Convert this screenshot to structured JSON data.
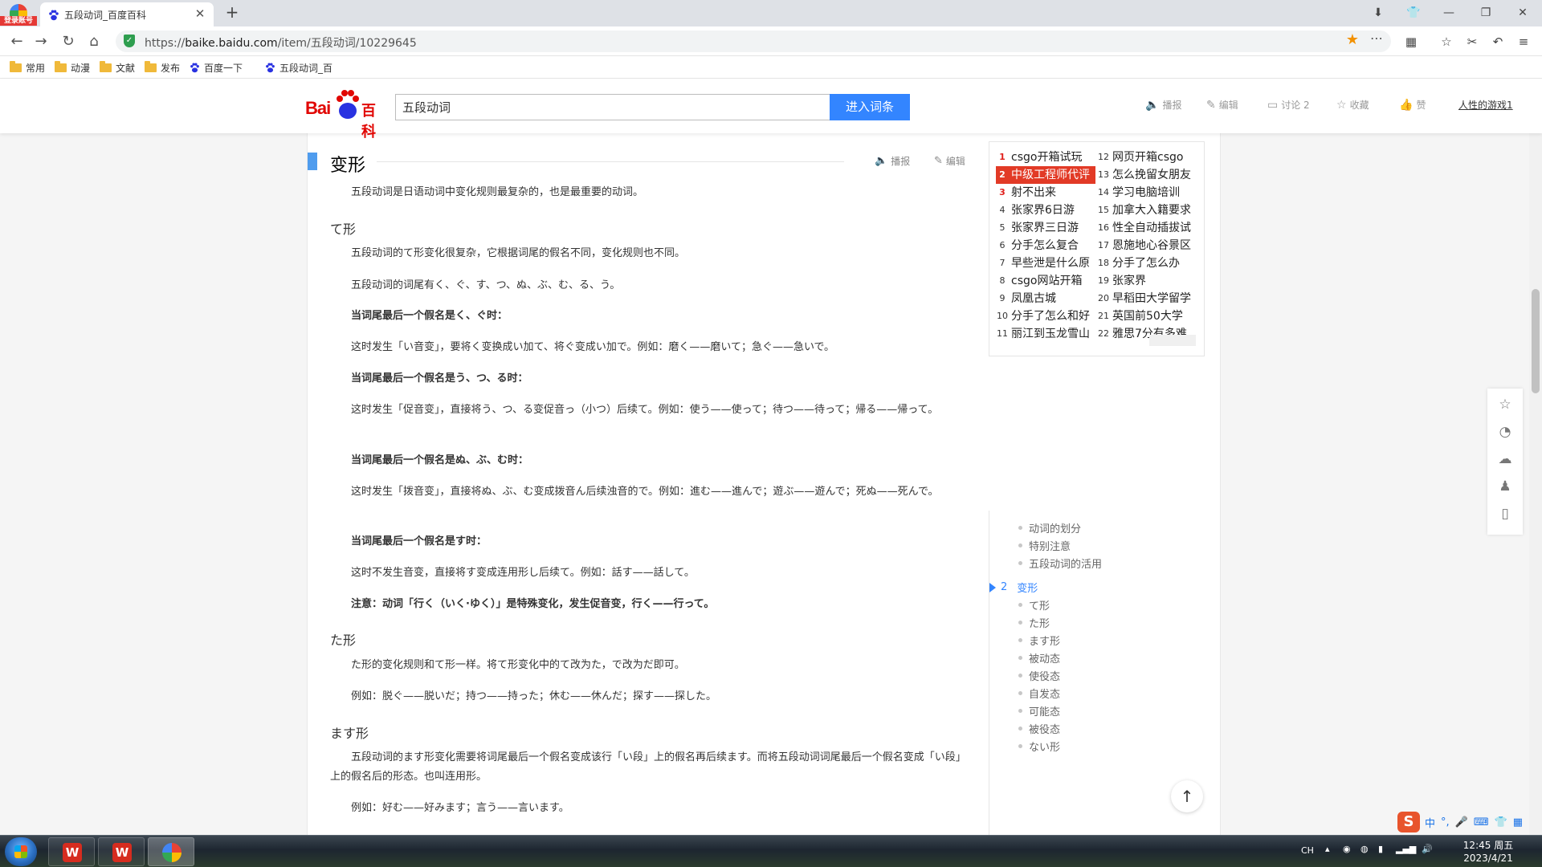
{
  "browser": {
    "login_badge": "登录账号",
    "tab_title": "五段动词_百度百科",
    "url_scheme": "https://",
    "url_host": "baike.baidu.com",
    "url_path": "/item/五段动词/10229645"
  },
  "bookmarks": [
    {
      "label": "常用",
      "icon": "folder-icon"
    },
    {
      "label": "动漫",
      "icon": "folder-icon"
    },
    {
      "label": "文献",
      "icon": "folder-icon"
    },
    {
      "label": "发布",
      "icon": "folder-icon"
    },
    {
      "label": "百度一下",
      "icon": "baidu-paw-icon"
    },
    {
      "label": "五段动词_百",
      "icon": "baidu-paw-icon"
    }
  ],
  "header": {
    "logo_bai": "Bai",
    "logo_baike": "百科",
    "search_value": "五段动词",
    "search_button": "进入词条",
    "actions": {
      "broadcast": "播报",
      "edit": "编辑",
      "discuss": "讨论 2",
      "collect": "收藏",
      "like": "赞"
    },
    "user": "人性的游戏1"
  },
  "section": {
    "title": "变形",
    "broadcast": "播报",
    "edit": "编辑"
  },
  "article": {
    "intro": "五段动词是日语动词中变化规则最复杂的，也是最重要的动词。",
    "h_te": "て形",
    "te_1": "五段动词的て形变化很复杂，它根据词尾的假名不同，变化规则也不同。",
    "te_2": "五段动词的词尾有く、ぐ、す、つ、ぬ、ぶ、む、る、う。",
    "te_3": "当词尾最后一个假名是く、ぐ时：",
    "te_4": "这时发生「い音变」，要将く变换成い加て、将ぐ变成い加で。例如：磨く——磨いて；急ぐ——急いで。",
    "te_5": "当词尾最后一个假名是う、つ、る时：",
    "te_6": "这时发生「促音变」，直接将う、つ、る变促音っ（小つ）后续て。例如：使う——使って；待つ——待って；帰る——帰って。",
    "te_7": "当词尾最后一个假名是ぬ、ぶ、む时：",
    "te_8": "这时发生「拨音变」，直接将ぬ、ぶ、む变成拨音ん后续浊音的で。例如：進む——進んで；遊ぶ——遊んで；死ぬ——死んで。",
    "te_9": "当词尾最后一个假名是す时：",
    "te_10": "这时不发生音变，直接将す变成连用形し后续て。例如：話す——話して。",
    "te_11": "注意：动词「行く（いく·ゆく）」是特殊变化，发生促音变，行く——行って。",
    "h_ta": "た形",
    "ta_1": "た形的变化规则和て形一样。将て形变化中的て改为た，で改为だ即可。",
    "ta_2": "例如：脱ぐ——脱いだ；持つ——持った；休む——休んだ；探す——探した。",
    "h_masu": "ます形",
    "masu_1": "五段动词的ます形变化需要将词尾最后一个假名变成该行「い段」上的假名再后续ます。而将五段动词词尾最后一个假名变成「い段」上的假名后的形态。也叫连用形。",
    "masu_2": "例如：好む——好みます；言う——言います。"
  },
  "hotlist": {
    "left": [
      {
        "n": "1",
        "t": "csgo开箱试玩"
      },
      {
        "n": "2",
        "t": "中级工程师代评"
      },
      {
        "n": "3",
        "t": "射不出来"
      },
      {
        "n": "4",
        "t": "张家界6日游"
      },
      {
        "n": "5",
        "t": "张家界三日游"
      },
      {
        "n": "6",
        "t": "分手怎么复合"
      },
      {
        "n": "7",
        "t": "早些泄是什么原"
      },
      {
        "n": "8",
        "t": "csgo网站开箱"
      },
      {
        "n": "9",
        "t": "凤凰古城"
      },
      {
        "n": "10",
        "t": "分手了怎么和好"
      },
      {
        "n": "11",
        "t": "丽江到玉龙雪山"
      }
    ],
    "right": [
      {
        "n": "12",
        "t": "网页开箱csgo"
      },
      {
        "n": "13",
        "t": "怎么挽留女朋友"
      },
      {
        "n": "14",
        "t": "学习电脑培训"
      },
      {
        "n": "15",
        "t": "加拿大入籍要求"
      },
      {
        "n": "16",
        "t": "性全自动插拔试"
      },
      {
        "n": "17",
        "t": "恩施地心谷景区"
      },
      {
        "n": "18",
        "t": "分手了怎么办"
      },
      {
        "n": "19",
        "t": "张家界"
      },
      {
        "n": "20",
        "t": "早稻田大学留学"
      },
      {
        "n": "21",
        "t": "英国前50大学"
      },
      {
        "n": "22",
        "t": "雅思7分有多难"
      }
    ]
  },
  "toc": {
    "sub_a": [
      "动词的划分",
      "特别注意",
      "五段动词的活用"
    ],
    "active_num": "2",
    "active_label": "变形",
    "sub_b": [
      "て形",
      "た形",
      "ます形",
      "被动态",
      "使役态",
      "自发态",
      "可能态",
      "被役态",
      "ない形"
    ]
  },
  "ime": {
    "logo": "S",
    "mode": "中"
  },
  "taskbar": {
    "lang": "CH",
    "time": "12:45 周五",
    "date": "2023/4/21"
  },
  "colors": {
    "accent": "#3385ff",
    "baidu_red": "#e10602",
    "hot_highlight": "#e23a26"
  }
}
